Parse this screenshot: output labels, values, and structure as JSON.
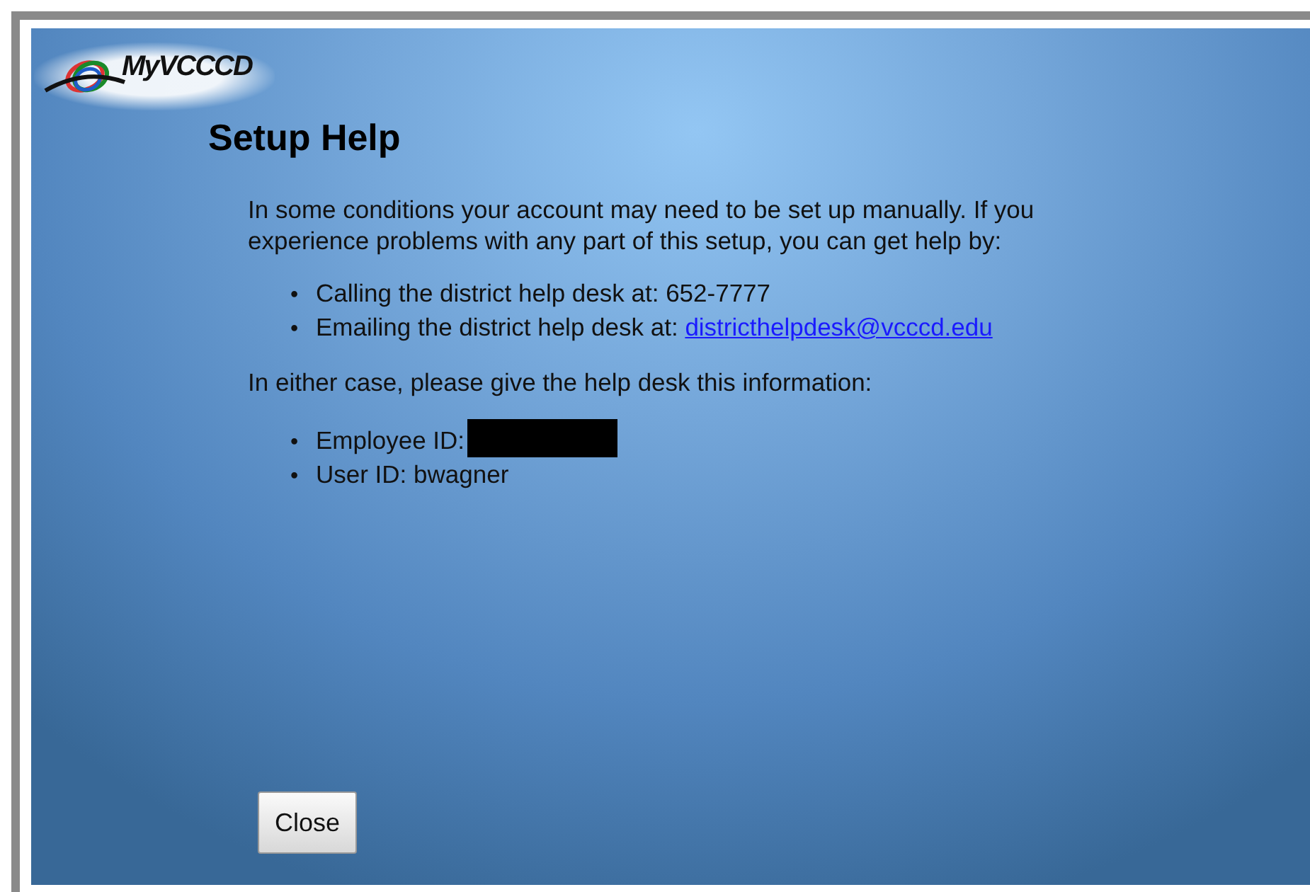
{
  "logo": {
    "text": "MyVCCCD"
  },
  "title": "Setup Help",
  "intro": "In some conditions your account may need to be set up manually. If you experience problems with any part of this setup, you can get help by:",
  "contact_methods": [
    {
      "bullet": "•",
      "label": "Calling the district help desk at: 652-7777"
    },
    {
      "bullet": "•",
      "label": "Emailing the district help desk at: ",
      "link": "districthelpdesk@vcccd.edu"
    }
  ],
  "info_intro": "In either case, please give the help desk this information:",
  "info_items": [
    {
      "bullet": "•",
      "label": "Employee ID:",
      "redacted": true
    },
    {
      "bullet": "•",
      "label": "User ID: bwagner",
      "redacted": false
    }
  ],
  "buttons": [
    {
      "label": "Close"
    }
  ]
}
